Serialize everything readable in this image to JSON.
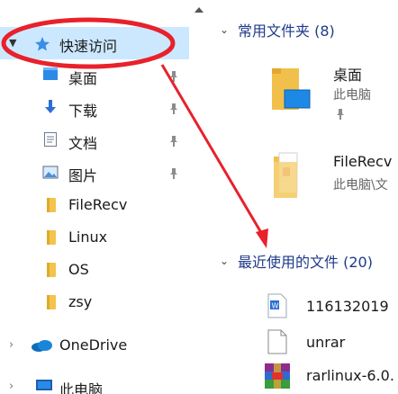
{
  "nav": {
    "quick_access": "快速访问",
    "items": [
      {
        "label": "桌面",
        "icon": "desktop-icon"
      },
      {
        "label": "下载",
        "icon": "download-icon"
      },
      {
        "label": "文档",
        "icon": "document-icon"
      },
      {
        "label": "图片",
        "icon": "pictures-icon"
      },
      {
        "label": "FileRecv",
        "icon": "folder-icon"
      },
      {
        "label": "Linux",
        "icon": "folder-icon"
      },
      {
        "label": "OS",
        "icon": "folder-icon"
      },
      {
        "label": "zsy",
        "icon": "folder-icon"
      }
    ],
    "onedrive": "OneDrive",
    "this_pc": "此电脑"
  },
  "content": {
    "frequent_header": "常用文件夹 (8)",
    "frequent": [
      {
        "name": "桌面",
        "location": "此电脑"
      },
      {
        "name": "FileRecv",
        "location": "此电脑\\文"
      }
    ],
    "recent_header": "最近使用的文件 (20)",
    "recent": [
      {
        "name": "116132019",
        "icon": "word-doc-icon"
      },
      {
        "name": "unrar",
        "icon": "blank-file-icon"
      },
      {
        "name": "rarlinux-6.0.",
        "icon": "winrar-archive-icon"
      }
    ]
  },
  "colors": {
    "selection": "#cce8ff",
    "header_text": "#1f3a8a",
    "annotation_red": "#e8212b",
    "folder_yellow": "#f3c44b"
  }
}
